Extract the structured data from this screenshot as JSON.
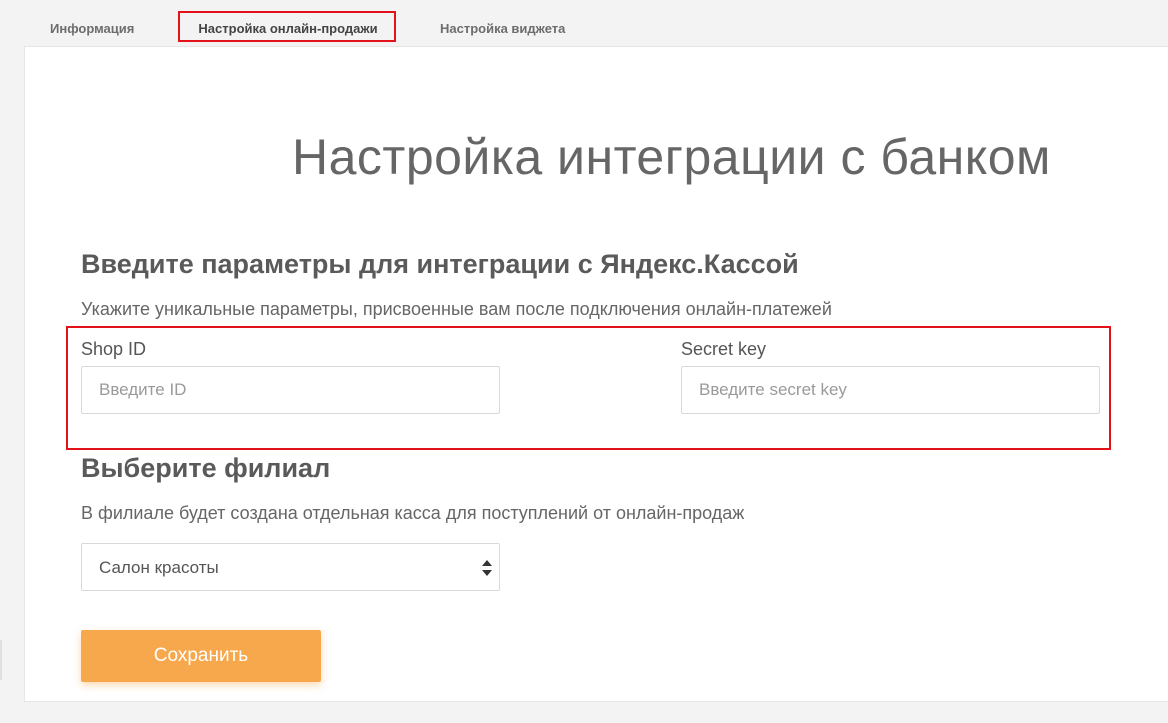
{
  "tabs": [
    {
      "label": "Информация"
    },
    {
      "label": "Настройка онлайн-продажи"
    },
    {
      "label": "Настройка виджета"
    }
  ],
  "active_tab": "Настройка онлайн-продажи",
  "page": {
    "title": "Настройка интеграции с банком"
  },
  "integration": {
    "heading": "Введите параметры для интеграции с Яндекс.Кассой",
    "description": "Укажите уникальные параметры, присвоенные вам после подключения онлайн-платежей",
    "shop_id": {
      "label": "Shop ID",
      "placeholder": "Введите ID",
      "value": ""
    },
    "secret_key": {
      "label": "Secret key",
      "placeholder": "Введите secret key",
      "value": ""
    }
  },
  "branch": {
    "heading": "Выберите филиал",
    "description": "В филиале будет создана отдельная касса для поступлений от онлайн-продаж",
    "selected": "Салон красоты"
  },
  "actions": {
    "save_label": "Сохранить"
  },
  "colors": {
    "accent": "#f8a84c",
    "highlight": "#e3111a",
    "background": "#f3f3f4"
  }
}
